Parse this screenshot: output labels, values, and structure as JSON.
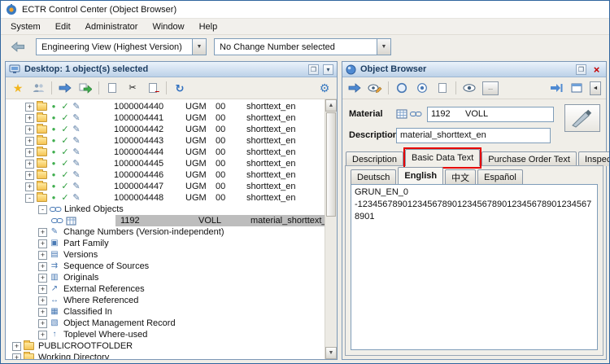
{
  "window": {
    "title": "ECTR Control Center (Object Browser)",
    "menu_items": [
      "System",
      "Edit",
      "Administrator",
      "Window",
      "Help"
    ],
    "view_dropdown": "Engineering View (Highest Version)",
    "change_dropdown": "No Change Number selected"
  },
  "desktop": {
    "title": "Desktop: 1 object(s) selected",
    "objects": [
      {
        "id": "1000004440",
        "type": "UGM",
        "version": "00",
        "description": "shorttext_en"
      },
      {
        "id": "1000004441",
        "type": "UGM",
        "version": "00",
        "description": "shorttext_en"
      },
      {
        "id": "1000004442",
        "type": "UGM",
        "version": "00",
        "description": "shorttext_en"
      },
      {
        "id": "1000004443",
        "type": "UGM",
        "version": "00",
        "description": "shorttext_en"
      },
      {
        "id": "1000004444",
        "type": "UGM",
        "version": "00",
        "description": "shorttext_en"
      },
      {
        "id": "1000004445",
        "type": "UGM",
        "version": "00",
        "description": "shorttext_en"
      },
      {
        "id": "1000004446",
        "type": "UGM",
        "version": "00",
        "description": "shorttext_en"
      },
      {
        "id": "1000004447",
        "type": "UGM",
        "version": "00",
        "description": "shorttext_en"
      },
      {
        "id": "1000004448",
        "type": "UGM",
        "version": "00",
        "description": "shorttext_en"
      }
    ],
    "linked_objects_label": "Linked Objects",
    "linked_object": {
      "id": "1192",
      "type": "VOLL",
      "description": "material_shorttext_en"
    },
    "nodes": [
      {
        "label": "Change Numbers (Version-independent)",
        "icon": "✎"
      },
      {
        "label": "Part Family",
        "icon": "▣"
      },
      {
        "label": "Versions",
        "icon": "▤"
      },
      {
        "label": "Sequence of Sources",
        "icon": "⇉"
      },
      {
        "label": "Originals",
        "icon": "▥"
      },
      {
        "label": "External References",
        "icon": "↗"
      },
      {
        "label": "Where Referenced",
        "icon": "↔"
      },
      {
        "label": "Classified In",
        "icon": "▦"
      },
      {
        "label": "Object Management Record",
        "icon": "▧"
      },
      {
        "label": "Toplevel Where-used",
        "icon": "↑"
      }
    ],
    "roots": [
      "PUBLICROOTFOLDER",
      "Working Directory"
    ]
  },
  "browser": {
    "title": "Object Browser",
    "material_label": "Material",
    "material_value": "1192      VOLL",
    "description_label": "Description",
    "description_value": "material_shorttext_en",
    "tabs": [
      "Description",
      "Basic Data Text",
      "Purchase Order Text",
      "Inspection..."
    ],
    "lang_tabs": [
      "Deutsch",
      "English",
      "中文",
      "Español"
    ],
    "text_line1": "GRUN_EN_0",
    "text_line2": "-123456789012345678901234567890123456789012345678901",
    "more_label": "..."
  },
  "icons": {
    "star": "★",
    "check": "✓",
    "pencil": "✎",
    "scissors": "✂",
    "gear": "⚙",
    "refresh": "↻",
    "dot": "●",
    "eye": "◉",
    "plus": "+",
    "minus": "-",
    "up_arrow": "▲",
    "down_arrow": "▼",
    "left_arrow": "◄",
    "right_arrow": "►",
    "close": "×",
    "combo_arrow": "▼"
  }
}
